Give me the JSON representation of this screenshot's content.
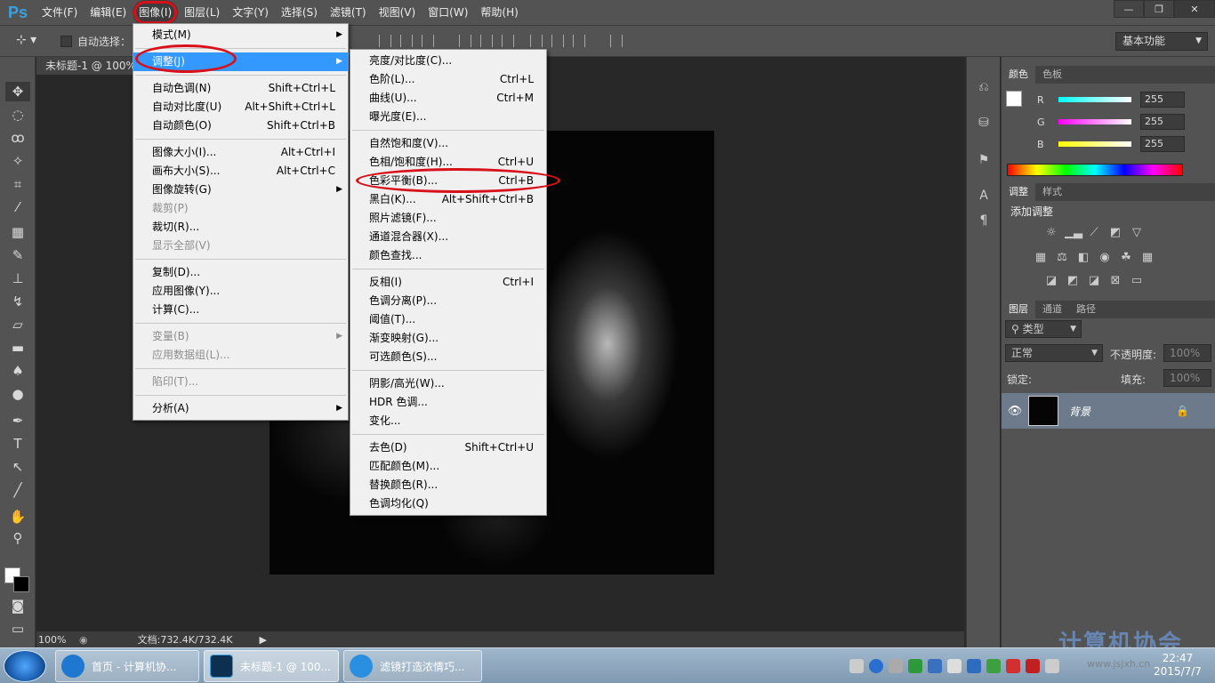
{
  "app": {
    "logo": "Ps"
  },
  "menubar": {
    "items": [
      "文件(F)",
      "编辑(E)",
      "图像(I)",
      "图层(L)",
      "文字(Y)",
      "选择(S)",
      "滤镜(T)",
      "视图(V)",
      "窗口(W)",
      "帮助(H)"
    ],
    "active_index": 2
  },
  "window_controls": {
    "minimize": "—",
    "restore": "❐",
    "close": "✕"
  },
  "options_bar": {
    "auto_select_label": "自动选择：",
    "workspace": "基本功能"
  },
  "document": {
    "tab_title": "未标题-1 @ 100%",
    "zoom": "100%",
    "info": "文档:732.4K/732.4K"
  },
  "image_menu": [
    {
      "label": "模式(M)",
      "shortcut": "",
      "submenu": true,
      "disabled": false
    },
    {
      "sep": true
    },
    {
      "label": "调整(J)",
      "shortcut": "",
      "submenu": true,
      "disabled": false,
      "highlight": true
    },
    {
      "sep": true
    },
    {
      "label": "自动色调(N)",
      "shortcut": "Shift+Ctrl+L"
    },
    {
      "label": "自动对比度(U)",
      "shortcut": "Alt+Shift+Ctrl+L"
    },
    {
      "label": "自动颜色(O)",
      "shortcut": "Shift+Ctrl+B"
    },
    {
      "sep": true
    },
    {
      "label": "图像大小(I)...",
      "shortcut": "Alt+Ctrl+I"
    },
    {
      "label": "画布大小(S)...",
      "shortcut": "Alt+Ctrl+C"
    },
    {
      "label": "图像旋转(G)",
      "shortcut": "",
      "submenu": true
    },
    {
      "label": "裁剪(P)",
      "shortcut": "",
      "disabled": true
    },
    {
      "label": "裁切(R)...",
      "shortcut": ""
    },
    {
      "label": "显示全部(V)",
      "shortcut": "",
      "disabled": true
    },
    {
      "sep": true
    },
    {
      "label": "复制(D)...",
      "shortcut": ""
    },
    {
      "label": "应用图像(Y)...",
      "shortcut": ""
    },
    {
      "label": "计算(C)...",
      "shortcut": ""
    },
    {
      "sep": true
    },
    {
      "label": "变量(B)",
      "shortcut": "",
      "submenu": true,
      "disabled": true
    },
    {
      "label": "应用数据组(L)...",
      "shortcut": "",
      "disabled": true
    },
    {
      "sep": true
    },
    {
      "label": "陷印(T)...",
      "shortcut": "",
      "disabled": true
    },
    {
      "sep": true
    },
    {
      "label": "分析(A)",
      "shortcut": "",
      "submenu": true
    }
  ],
  "adjust_menu": [
    {
      "label": "亮度/对比度(C)...",
      "shortcut": ""
    },
    {
      "label": "色阶(L)...",
      "shortcut": "Ctrl+L"
    },
    {
      "label": "曲线(U)...",
      "shortcut": "Ctrl+M"
    },
    {
      "label": "曝光度(E)...",
      "shortcut": ""
    },
    {
      "sep": true
    },
    {
      "label": "自然饱和度(V)...",
      "shortcut": ""
    },
    {
      "label": "色相/饱和度(H)...",
      "shortcut": "Ctrl+U"
    },
    {
      "label": "色彩平衡(B)...",
      "shortcut": "Ctrl+B",
      "circled": true
    },
    {
      "label": "黑白(K)...",
      "shortcut": "Alt+Shift+Ctrl+B"
    },
    {
      "label": "照片滤镜(F)...",
      "shortcut": ""
    },
    {
      "label": "通道混合器(X)...",
      "shortcut": ""
    },
    {
      "label": "颜色查找...",
      "shortcut": ""
    },
    {
      "sep": true
    },
    {
      "label": "反相(I)",
      "shortcut": "Ctrl+I"
    },
    {
      "label": "色调分离(P)...",
      "shortcut": ""
    },
    {
      "label": "阈值(T)...",
      "shortcut": ""
    },
    {
      "label": "渐变映射(G)...",
      "shortcut": ""
    },
    {
      "label": "可选颜色(S)...",
      "shortcut": ""
    },
    {
      "sep": true
    },
    {
      "label": "阴影/高光(W)...",
      "shortcut": ""
    },
    {
      "label": "HDR 色调...",
      "shortcut": ""
    },
    {
      "label": "变化...",
      "shortcut": ""
    },
    {
      "sep": true
    },
    {
      "label": "去色(D)",
      "shortcut": "Shift+Ctrl+U"
    },
    {
      "label": "匹配颜色(M)...",
      "shortcut": ""
    },
    {
      "label": "替换颜色(R)...",
      "shortcut": ""
    },
    {
      "label": "色调均化(Q)",
      "shortcut": ""
    }
  ],
  "color_panel": {
    "tabs": [
      "颜色",
      "色板"
    ],
    "channels": [
      {
        "label": "R",
        "value": "255",
        "color": "#00ffff"
      },
      {
        "label": "G",
        "value": "255",
        "color": "#ff00ff"
      },
      {
        "label": "B",
        "value": "255",
        "color": "#ffff00"
      }
    ]
  },
  "adjust_panel": {
    "tabs": [
      "调整",
      "样式"
    ],
    "title": "添加调整"
  },
  "layers_panel": {
    "tabs": [
      "图层",
      "通道",
      "路径"
    ],
    "filter_kind": "类型",
    "blend_mode": "正常",
    "opacity_label": "不透明度:",
    "opacity_value": "100%",
    "lock_label": "锁定:",
    "fill_label": "填充:",
    "fill_value": "100%",
    "layer_name": "背景"
  },
  "taskbar": {
    "items": [
      {
        "label": "首页 - 计算机协...",
        "icon_color": "#1e78d0"
      },
      {
        "label": "未标题-1 @ 100...",
        "icon_color": "#0e3050"
      },
      {
        "label": "滤镜打造浓情巧...",
        "icon_color": "#2a8fe0"
      }
    ],
    "time": "22:47",
    "date": "2015/7/7"
  },
  "watermark": {
    "text": "计算机协会",
    "url": "www.jsjxh.cn"
  },
  "colors": {
    "ps_blue": "#3aa0e0",
    "menu_highlight": "#3399ff",
    "annotation_red": "#d8101a"
  }
}
